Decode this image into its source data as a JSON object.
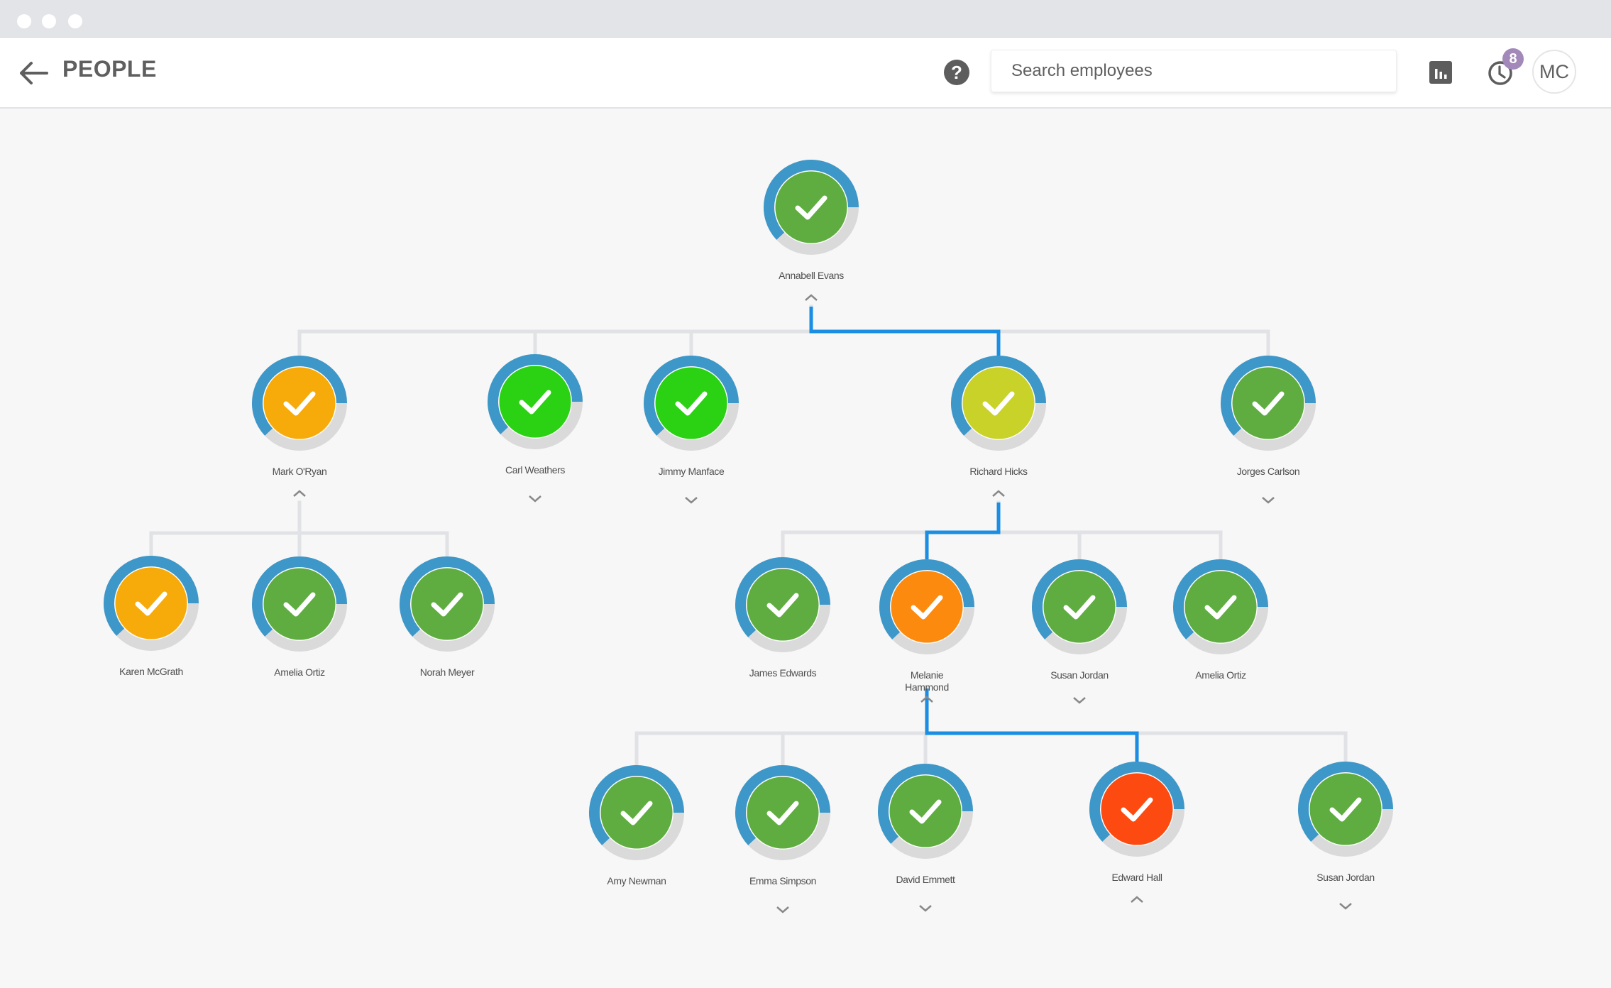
{
  "window": {
    "controls": [
      "close",
      "minimize",
      "maximize"
    ]
  },
  "header": {
    "back_icon": "arrow-left-icon",
    "title": "PEOPLE",
    "help_icon": "question-icon",
    "help_glyph": "?",
    "search": {
      "placeholder": "Search employees",
      "value": ""
    },
    "stats_icon": "bar-chart-icon",
    "history_icon": "clock-icon",
    "notification_count": "8",
    "avatar_initials": "MC"
  },
  "colors": {
    "progress_ring": "#3d97c8",
    "ring_track": "#dadada",
    "connector": "#e1e2e5",
    "active_path": "#1a8ee3",
    "status_green": "#5fad41",
    "status_bright_green": "#2bd113",
    "status_lime": "#c9d228",
    "status_amber": "#f7ab0a",
    "status_orange": "#fb8a0e",
    "status_red": "#fd4a10"
  },
  "org_chart": {
    "nodes": [
      {
        "id": "annabell-evans",
        "name": "Annabell Evans",
        "parent": null,
        "status": "status_green",
        "progress": 0.62,
        "toggle": "up",
        "active": true
      },
      {
        "id": "mark-oryan",
        "name": "Mark O'Ryan",
        "parent": "annabell-evans",
        "status": "status_amber",
        "progress": 0.62,
        "toggle": "up",
        "active": false
      },
      {
        "id": "carl-weathers",
        "name": "Carl Weathers",
        "parent": "annabell-evans",
        "status": "status_bright_green",
        "progress": 0.62,
        "toggle": "down",
        "active": false
      },
      {
        "id": "jimmy-manface",
        "name": "Jimmy Manface",
        "parent": "annabell-evans",
        "status": "status_bright_green",
        "progress": 0.62,
        "toggle": "down",
        "active": false
      },
      {
        "id": "richard-hicks",
        "name": "Richard Hicks",
        "parent": "annabell-evans",
        "status": "status_lime",
        "progress": 0.62,
        "toggle": "up",
        "active": true
      },
      {
        "id": "jorges-carlson",
        "name": "Jorges Carlson",
        "parent": "annabell-evans",
        "status": "status_green",
        "progress": 0.62,
        "toggle": "down",
        "active": false
      },
      {
        "id": "karen-mcgrath",
        "name": "Karen McGrath",
        "parent": "mark-oryan",
        "status": "status_amber",
        "progress": 0.62,
        "toggle": null,
        "active": false
      },
      {
        "id": "amelia-ortiz-1",
        "name": "Amelia Ortiz",
        "parent": "mark-oryan",
        "status": "status_green",
        "progress": 0.62,
        "toggle": null,
        "active": false
      },
      {
        "id": "norah-meyer",
        "name": "Norah Meyer",
        "parent": "mark-oryan",
        "status": "status_green",
        "progress": 0.62,
        "toggle": null,
        "active": false
      },
      {
        "id": "james-edwards",
        "name": "James Edwards",
        "parent": "richard-hicks",
        "status": "status_green",
        "progress": 0.62,
        "toggle": null,
        "active": false
      },
      {
        "id": "melanie-hammond",
        "name": "Melanie Hammond",
        "parent": "richard-hicks",
        "status": "status_orange",
        "progress": 0.62,
        "toggle": "up",
        "active": true
      },
      {
        "id": "susan-jordan-1",
        "name": "Susan Jordan",
        "parent": "richard-hicks",
        "status": "status_green",
        "progress": 0.62,
        "toggle": "down",
        "active": false
      },
      {
        "id": "amelia-ortiz-2",
        "name": "Amelia Ortiz",
        "parent": "richard-hicks",
        "status": "status_green",
        "progress": 0.62,
        "toggle": null,
        "active": false
      },
      {
        "id": "amy-newman",
        "name": "Amy Newman",
        "parent": "melanie-hammond",
        "status": "status_green",
        "progress": 0.62,
        "toggle": null,
        "active": false
      },
      {
        "id": "emma-simpson",
        "name": "Emma Simpson",
        "parent": "melanie-hammond",
        "status": "status_green",
        "progress": 0.62,
        "toggle": "down",
        "active": false
      },
      {
        "id": "david-emmett",
        "name": "David Emmett",
        "parent": "melanie-hammond",
        "status": "status_green",
        "progress": 0.62,
        "toggle": "down",
        "active": false
      },
      {
        "id": "edward-hall",
        "name": "Edward Hall",
        "parent": "melanie-hammond",
        "status": "status_red",
        "progress": 0.62,
        "toggle": "up",
        "active": true
      },
      {
        "id": "susan-jordan-2",
        "name": "Susan Jordan",
        "parent": "melanie-hammond",
        "status": "status_green",
        "progress": 0.62,
        "toggle": "down",
        "active": false
      }
    ]
  }
}
